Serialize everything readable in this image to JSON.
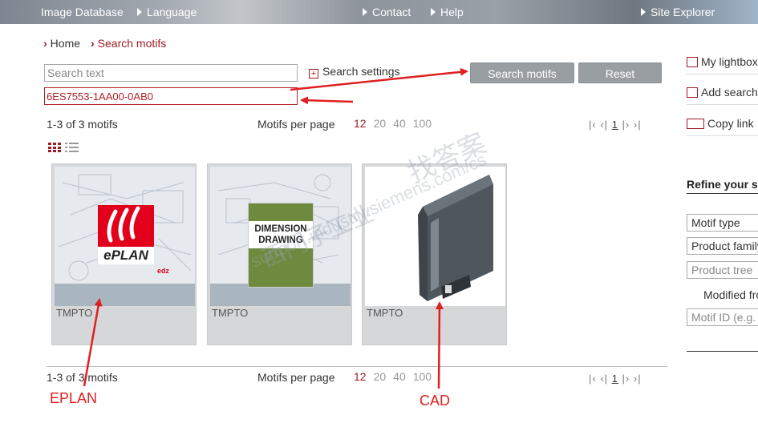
{
  "topbar": {
    "image_database": "Image Database",
    "language": "Language",
    "contact": "Contact",
    "help": "Help",
    "site_explorer": "Site Explorer"
  },
  "breadcrumb": {
    "home": "Home",
    "current": "Search motifs"
  },
  "search": {
    "placeholder": "Search text",
    "id_value": "6ES7553-1AA00-0AB0",
    "settings_label": "Search settings",
    "search_button": "Search motifs",
    "reset_button": "Reset"
  },
  "results": {
    "count_text": "1-3 of 3 motifs",
    "per_page_label": "Motifs per page",
    "per_page_options": [
      "12",
      "20",
      "40",
      "100"
    ],
    "selected_per_page": "12",
    "current_page": "1"
  },
  "cards": [
    {
      "label": "TMPTO",
      "kind": "eplan",
      "logo_text": "ePLAN",
      "logo_sub": "edz"
    },
    {
      "label": "TMPTO",
      "kind": "dimension",
      "line1": "DIMENSION",
      "line2": "DRAWING"
    },
    {
      "label": "TMPTO",
      "kind": "cad"
    }
  ],
  "right_panel": {
    "lightbox": "My lightbox",
    "add_search": "Add search",
    "copy_link": "Copy link",
    "refine_title": "Refine your se",
    "motif_type": "Motif type",
    "product_family": "Product family",
    "product_tree": "Product tree",
    "modified_from": "Modified fro",
    "motif_id": "Motif ID (e.g."
  },
  "annotations": {
    "eplan": "EPLAN",
    "cad": "CAD"
  },
  "watermark": {
    "cn1": "找答案",
    "cn2": "西门子工业",
    "url": "support.industry.siemens.com/cs"
  },
  "colors": {
    "accent": "#9b1c24",
    "annotation": "#e02020",
    "button": "#999ea3"
  }
}
